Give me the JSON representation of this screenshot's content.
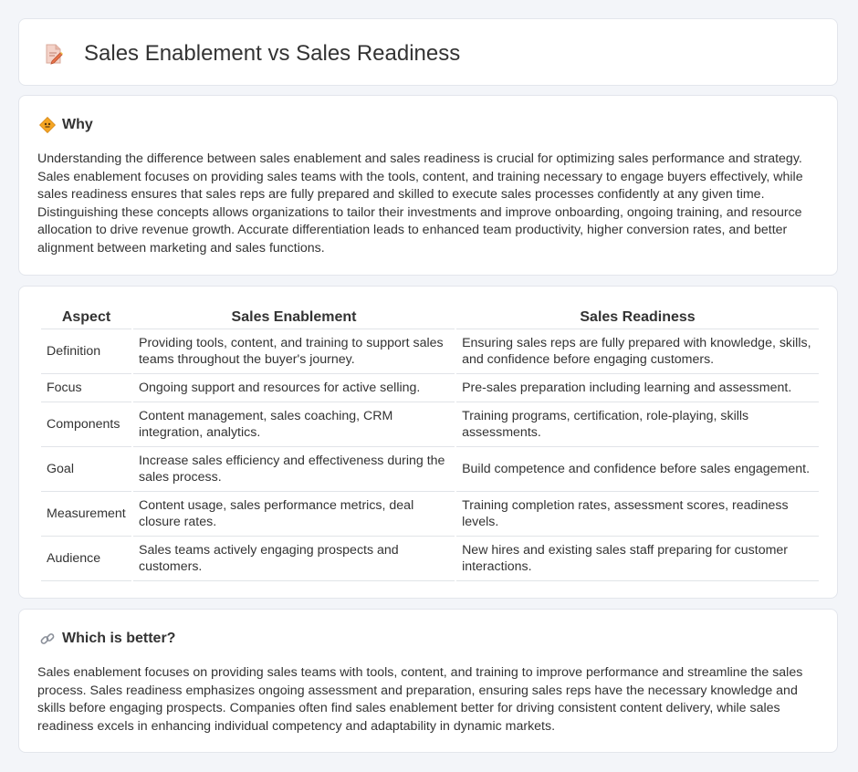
{
  "header": {
    "title": "Sales Enablement vs Sales Readiness",
    "icon": "document-pencil-icon"
  },
  "why": {
    "heading": "Why",
    "icon": "diamond-sign-icon",
    "body": "Understanding the difference between sales enablement and sales readiness is crucial for optimizing sales performance and strategy. Sales enablement focuses on providing sales teams with the tools, content, and training necessary to engage buyers effectively, while sales readiness ensures that sales reps are fully prepared and skilled to execute sales processes confidently at any given time. Distinguishing these concepts allows organizations to tailor their investments and improve onboarding, ongoing training, and resource allocation to drive revenue growth. Accurate differentiation leads to enhanced team productivity, higher conversion rates, and better alignment between marketing and sales functions."
  },
  "table": {
    "headers": [
      "Aspect",
      "Sales Enablement",
      "Sales Readiness"
    ],
    "rows": [
      [
        "Definition",
        "Providing tools, content, and training to support sales teams throughout the buyer's journey.",
        "Ensuring sales reps are fully prepared with knowledge, skills, and confidence before engaging customers."
      ],
      [
        "Focus",
        "Ongoing support and resources for active selling.",
        "Pre-sales preparation including learning and assessment."
      ],
      [
        "Components",
        "Content management, sales coaching, CRM integration, analytics.",
        "Training programs, certification, role-playing, skills assessments."
      ],
      [
        "Goal",
        "Increase sales efficiency and effectiveness during the sales process.",
        "Build competence and confidence before sales engagement."
      ],
      [
        "Measurement",
        "Content usage, sales performance metrics, deal closure rates.",
        "Training completion rates, assessment scores, readiness levels."
      ],
      [
        "Audience",
        "Sales teams actively engaging prospects and customers.",
        "New hires and existing sales staff preparing for customer interactions."
      ]
    ]
  },
  "better": {
    "heading": "Which is better?",
    "icon": "link-icon",
    "body": "Sales enablement focuses on providing sales teams with tools, content, and training to improve performance and streamline the sales process. Sales readiness emphasizes ongoing assessment and preparation, ensuring sales reps have the necessary knowledge and skills before engaging prospects. Companies often find sales enablement better for driving consistent content delivery, while sales readiness excels in enhancing individual competency and adaptability in dynamic markets."
  },
  "colors": {
    "page_bg": "#f3f5f9",
    "card_bg": "#ffffff",
    "text": "#333333",
    "icon_orange": "#f5a623"
  }
}
